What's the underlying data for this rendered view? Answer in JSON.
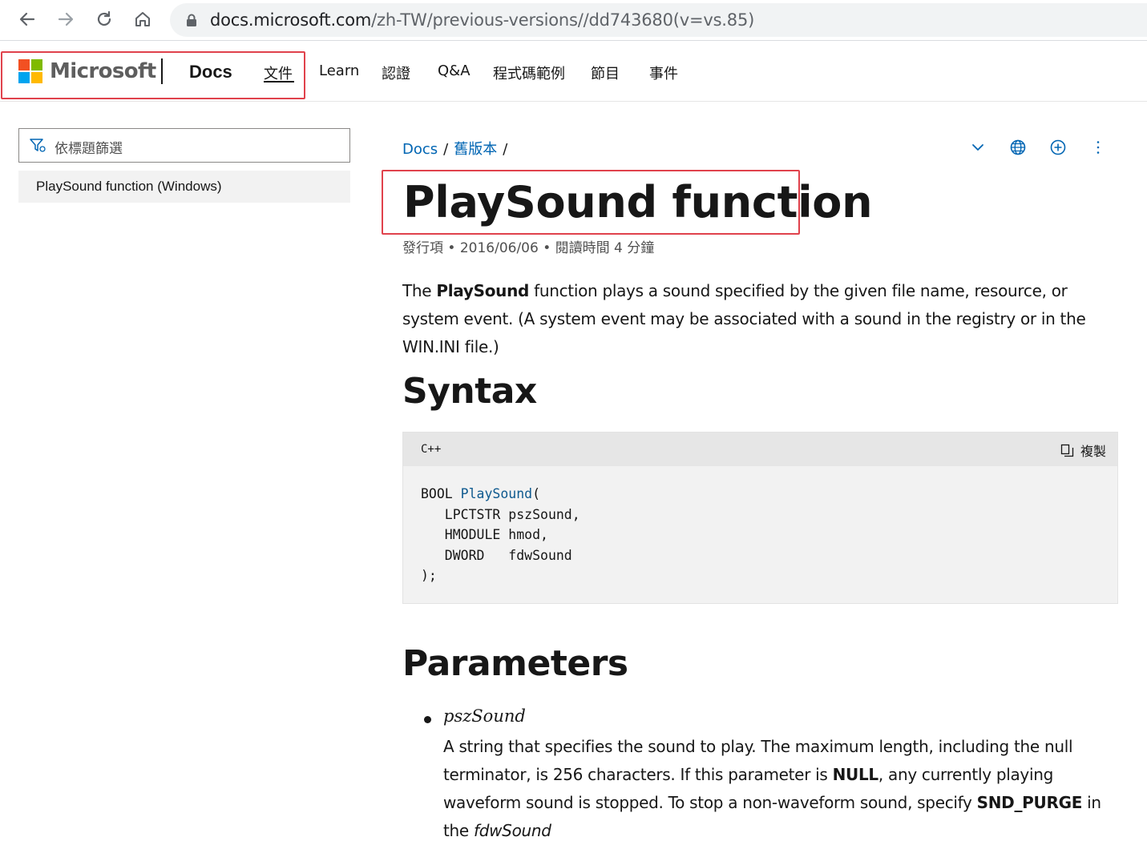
{
  "browser": {
    "url_host": "docs.microsoft.com",
    "url_path": "/zh-TW/previous-versions//dd743680(v=vs.85)"
  },
  "header": {
    "brand": "Microsoft",
    "site": "Docs",
    "nav": [
      "文件",
      "Learn",
      "認證",
      "Q&A",
      "程式碼範例",
      "節目",
      "事件"
    ]
  },
  "sidebar": {
    "filter_placeholder": "依標題篩選",
    "toc_items": [
      "PlaySound function (Windows)"
    ]
  },
  "breadcrumb": {
    "items": [
      "Docs",
      "舊版本"
    ],
    "sep": "/"
  },
  "article": {
    "title": "PlaySound function",
    "meta": "發行項 • 2016/06/06 • 閱讀時間 4 分鐘",
    "intro_before": "The ",
    "intro_bold": "PlaySound",
    "intro_after": " function plays a sound specified by the given file name, resource, or system event. (A system event may be associated with a sound in the registry or in the WIN.INI file.)",
    "syntax_heading": "Syntax",
    "code": {
      "language": "C++",
      "copy_label": "複製",
      "line1_prefix": "BOOL ",
      "line1_fn": "PlaySound",
      "line1_suffix": "(",
      "line2": "   LPCTSTR pszSound,",
      "line3": "   HMODULE hmod,",
      "line4": "   DWORD   fdwSound",
      "line5": ");"
    },
    "parameters_heading": "Parameters",
    "param": {
      "name": "pszSound",
      "desc_1": "A string that specifies the sound to play. The maximum length, including the null terminator, is 256 characters. If this parameter is ",
      "desc_null": "NULL",
      "desc_2": ", any currently playing waveform sound is stopped. To stop a non-waveform sound, specify ",
      "desc_purge": "SND_PURGE",
      "desc_3": " in the ",
      "desc_flag": "fdwSound"
    }
  },
  "colors": {
    "highlight_box": "#e0424c",
    "link": "#0065b3",
    "ms_red": "#f25022",
    "ms_green": "#7fba00",
    "ms_blue": "#00a4ef",
    "ms_yellow": "#ffb900"
  }
}
